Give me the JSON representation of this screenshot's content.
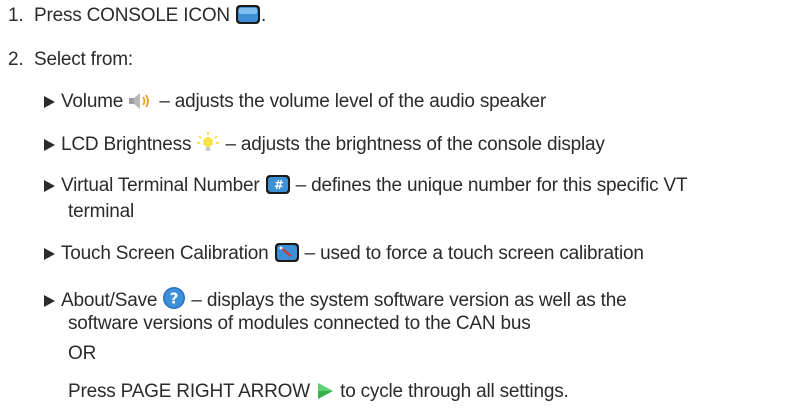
{
  "steps": [
    {
      "number": "1.",
      "text": "Press CONSOLE ICON",
      "suffix": "."
    },
    {
      "number": "2.",
      "text": "Select from:"
    }
  ],
  "options": [
    {
      "label": "Volume",
      "icon": "speaker-icon",
      "desc": " – adjusts the volume level of the audio speaker"
    },
    {
      "label": "LCD Brightness",
      "icon": "lightbulb-icon",
      "desc": " – adjusts the brightness of the console display"
    },
    {
      "label": "Virtual Terminal Number",
      "icon": "hash-icon",
      "desc": " – defines the unique number for this specific VT",
      "desc_line2": "terminal"
    },
    {
      "label": "Touch Screen Calibration",
      "icon": "calibration-icon",
      "desc": " – used to force a touch screen calibration"
    },
    {
      "label": "About/Save",
      "icon": "help-icon",
      "desc": " – displays the system software version as well as the",
      "desc_line2": "software versions of modules connected to the CAN bus"
    }
  ],
  "or_text": "OR",
  "final": {
    "before": "Press PAGE RIGHT ARROW",
    "icon": "right-arrow-icon",
    "after": " to cycle through all settings."
  },
  "colors": {
    "text": "#2b2b2b",
    "icon_blue": "#3d8fd6",
    "arrow_green": "#35b34a",
    "help_blue": "#2a6fc9",
    "bulb_yellow": "#f2d51f"
  }
}
